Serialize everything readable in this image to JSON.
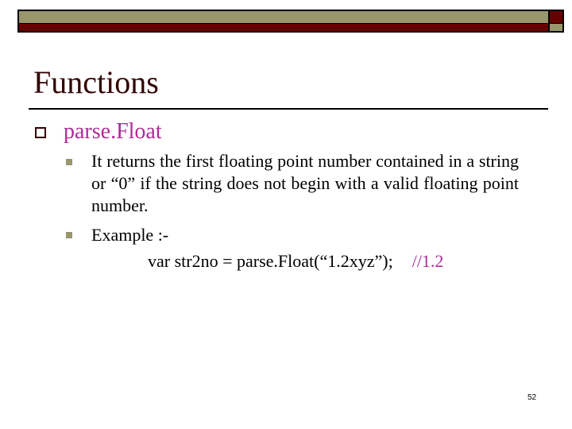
{
  "slide": {
    "title": "Functions",
    "page_number": "52",
    "colors": {
      "title": "#330000",
      "accent_magenta": "#b02a9a",
      "header_olive": "#98966b",
      "header_red": "#660000",
      "body_text": "#000000"
    },
    "bullets": [
      {
        "level": 1,
        "icon": "hollow-square-bullet-icon",
        "text": "parse.Float",
        "children": [
          {
            "level": 2,
            "icon": "filled-square-bullet-icon",
            "text": "It returns the first floating point number contained in a string or “0” if the string does not begin with a valid floating point number."
          },
          {
            "level": 2,
            "icon": "filled-square-bullet-icon",
            "text": "Example :-"
          }
        ]
      }
    ],
    "example": {
      "code": "var str2no = parse.Float(“1.2xyz”);",
      "comment": "//1.2"
    }
  }
}
